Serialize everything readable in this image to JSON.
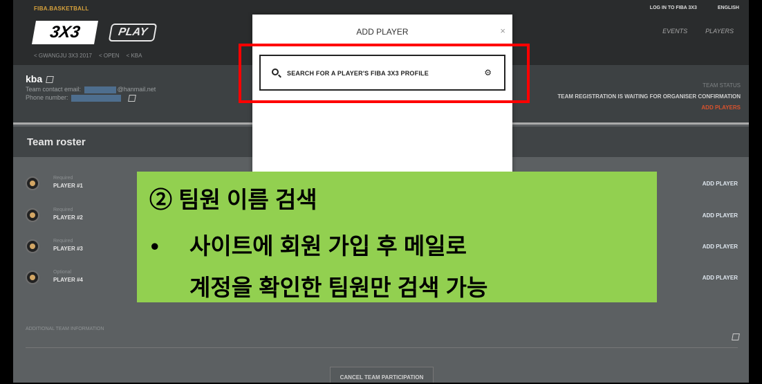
{
  "header": {
    "brand": "FIBA.BASKETBALL",
    "login_link": "LOG IN TO FIBA 3X3",
    "language": "ENGLISH",
    "logo_3x3": "3X3",
    "logo_play": "PLAY",
    "nav": [
      "EVENTS",
      "PLAYERS"
    ],
    "breadcrumbs": [
      "< GWANGJU 3X3 2017",
      "< OPEN",
      "< KBA"
    ]
  },
  "team": {
    "name": "kba",
    "email_label": "Team contact email:",
    "email_suffix": "@hanmail.net",
    "phone_label": "Phone number:",
    "status_label": "TEAM STATUS",
    "status_text": "TEAM REGISTRATION IS WAITING FOR ORGANISER CONFIRMATION",
    "status_link": "ADD PLAYERS"
  },
  "roster": {
    "title": "Team roster",
    "players": [
      {
        "tag": "Required",
        "name": "PLAYER #1",
        "action": "ADD PLAYER"
      },
      {
        "tag": "Required",
        "name": "PLAYER #2",
        "action": "ADD PLAYER"
      },
      {
        "tag": "Required",
        "name": "PLAYER #3",
        "action": "ADD PLAYER"
      },
      {
        "tag": "Optional",
        "name": "PLAYER #4",
        "action": "ADD PLAYER"
      }
    ],
    "additional_info": "ADDITIONAL TEAM INFORMATION",
    "cancel_button": "CANCEL TEAM PARTICIPATION"
  },
  "modal": {
    "title": "ADD PLAYER",
    "close": "×",
    "search_placeholder": "SEARCH FOR A PLAYER'S FIBA 3X3 PROFILE"
  },
  "callout": {
    "title": "② 팀원 이름 검색",
    "bullet": "•",
    "line1": "사이트에 회원 가입 후 메일로",
    "line2": "계정을 확인한 팀원만 검색 가능",
    "color": "#92d050"
  },
  "colors": {
    "annotation_red": "#ff0000",
    "accent_orange": "#d8522d",
    "brand_gold": "#d7a23c"
  }
}
